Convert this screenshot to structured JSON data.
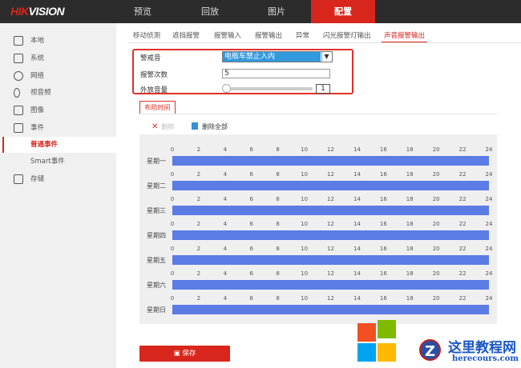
{
  "header": {
    "logo_red": "HIK",
    "logo_white": "VISION",
    "nav": [
      "预览",
      "回放",
      "图片",
      "配置"
    ],
    "active_nav": "配置"
  },
  "sidebar": {
    "items": [
      "本地",
      "系统",
      "网络",
      "视音频",
      "图像",
      "事件",
      "普通事件",
      "Smart事件",
      "存储"
    ]
  },
  "tabs": [
    "移动侦测",
    "遮挡报警",
    "报警输入",
    "报警输出",
    "异常",
    "闪光报警灯输出",
    "声音报警输出"
  ],
  "form": {
    "alarm_sound_label": "警戒音",
    "alarm_sound_value": "电瓶车禁止入内",
    "alarm_count_label": "报警次数",
    "alarm_count_value": "5",
    "volume_label": "外放音量",
    "volume_value": "1"
  },
  "schedule": {
    "tab": "布防时间",
    "delete": "删除",
    "delete_all": "删除全部",
    "days": [
      "星期一",
      "星期二",
      "星期三",
      "星期四",
      "星期五",
      "星期六",
      "星期日"
    ],
    "ticks": [
      "0",
      "2",
      "4",
      "6",
      "8",
      "10",
      "12",
      "14",
      "16",
      "18",
      "20",
      "22",
      "24"
    ],
    "coverage_hours": [
      0,
      24
    ]
  },
  "save_label": "保存",
  "watermark": {
    "title": "这里教程网",
    "url": "herecours.com",
    "z": "Z"
  },
  "colors": {
    "accent": "#d9261c",
    "bar": "#5b7be5"
  }
}
